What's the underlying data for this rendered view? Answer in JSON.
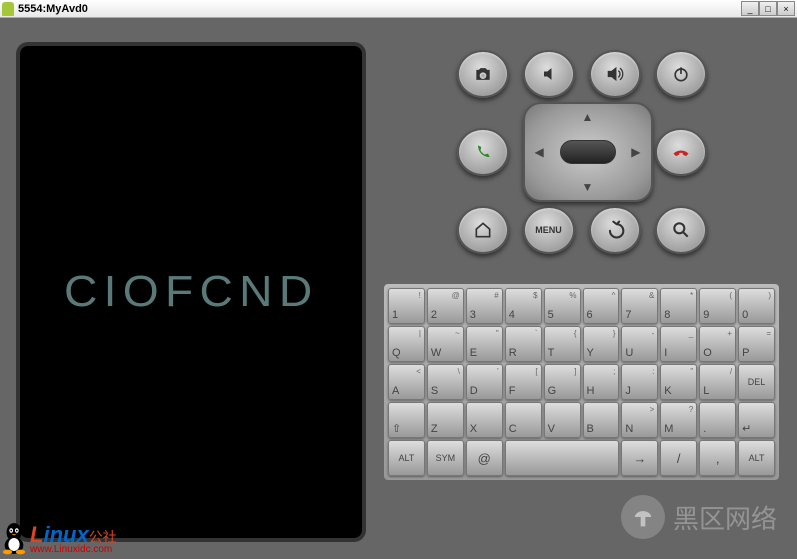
{
  "window": {
    "title": "5554:MyAvd0"
  },
  "screen": {
    "logo_text": "CIOFCND"
  },
  "hw_buttons": {
    "camera": "camera-icon",
    "vol_down": "volume-down-icon",
    "vol_up": "volume-up-icon",
    "power": "power-icon",
    "call": "call-icon",
    "end": "end-call-icon",
    "home": "home-icon",
    "menu": "MENU",
    "back": "back-icon",
    "search": "search-icon"
  },
  "keyboard": {
    "row1": [
      {
        "main": "1",
        "sup": "!"
      },
      {
        "main": "2",
        "sup": "@"
      },
      {
        "main": "3",
        "sup": "#"
      },
      {
        "main": "4",
        "sup": "$"
      },
      {
        "main": "5",
        "sup": "%"
      },
      {
        "main": "6",
        "sup": "^"
      },
      {
        "main": "7",
        "sup": "&"
      },
      {
        "main": "8",
        "sup": "*"
      },
      {
        "main": "9",
        "sup": "("
      },
      {
        "main": "0",
        "sup": ")"
      }
    ],
    "row2": [
      {
        "main": "Q",
        "sup": "|"
      },
      {
        "main": "W",
        "sup": "~"
      },
      {
        "main": "E",
        "sup": "\""
      },
      {
        "main": "R",
        "sup": "`"
      },
      {
        "main": "T",
        "sup": "{"
      },
      {
        "main": "Y",
        "sup": "}"
      },
      {
        "main": "U",
        "sup": "-"
      },
      {
        "main": "I",
        "sup": "_"
      },
      {
        "main": "O",
        "sup": "+"
      },
      {
        "main": "P",
        "sup": "="
      }
    ],
    "row3": [
      {
        "main": "A",
        "sup": "<"
      },
      {
        "main": "S",
        "sup": "\\"
      },
      {
        "main": "D",
        "sup": "'"
      },
      {
        "main": "F",
        "sup": "["
      },
      {
        "main": "G",
        "sup": "]"
      },
      {
        "main": "H",
        "sup": ";"
      },
      {
        "main": "J",
        "sup": ":"
      },
      {
        "main": "K",
        "sup": "\""
      },
      {
        "main": "L",
        "sup": "/"
      },
      {
        "main": "DEL",
        "sup": ""
      }
    ],
    "row4": [
      {
        "main": "⇧",
        "sup": ""
      },
      {
        "main": "Z",
        "sup": ""
      },
      {
        "main": "X",
        "sup": ""
      },
      {
        "main": "C",
        "sup": ""
      },
      {
        "main": "V",
        "sup": ""
      },
      {
        "main": "B",
        "sup": ""
      },
      {
        "main": "N",
        "sup": ">"
      },
      {
        "main": "M",
        "sup": "?"
      },
      {
        "main": ".",
        "sup": ""
      },
      {
        "main": "↵",
        "sup": ""
      }
    ],
    "row5": [
      {
        "main": "ALT",
        "sup": ""
      },
      {
        "main": "SYM",
        "sup": ""
      },
      {
        "main": "@",
        "sup": ""
      },
      {
        "main": "",
        "sup": "",
        "span": 3
      },
      {
        "main": "→",
        "sup": ""
      },
      {
        "main": "/",
        "sup": ""
      },
      {
        "main": ",",
        "sup": ""
      },
      {
        "main": "ALT",
        "sup": ""
      }
    ]
  },
  "watermarks": {
    "linux_l": "L",
    "linux_rest": "inux",
    "linux_suffix": "公社",
    "linux_url": "www.Linuxidc.com",
    "heiqu": "黑区网络"
  }
}
